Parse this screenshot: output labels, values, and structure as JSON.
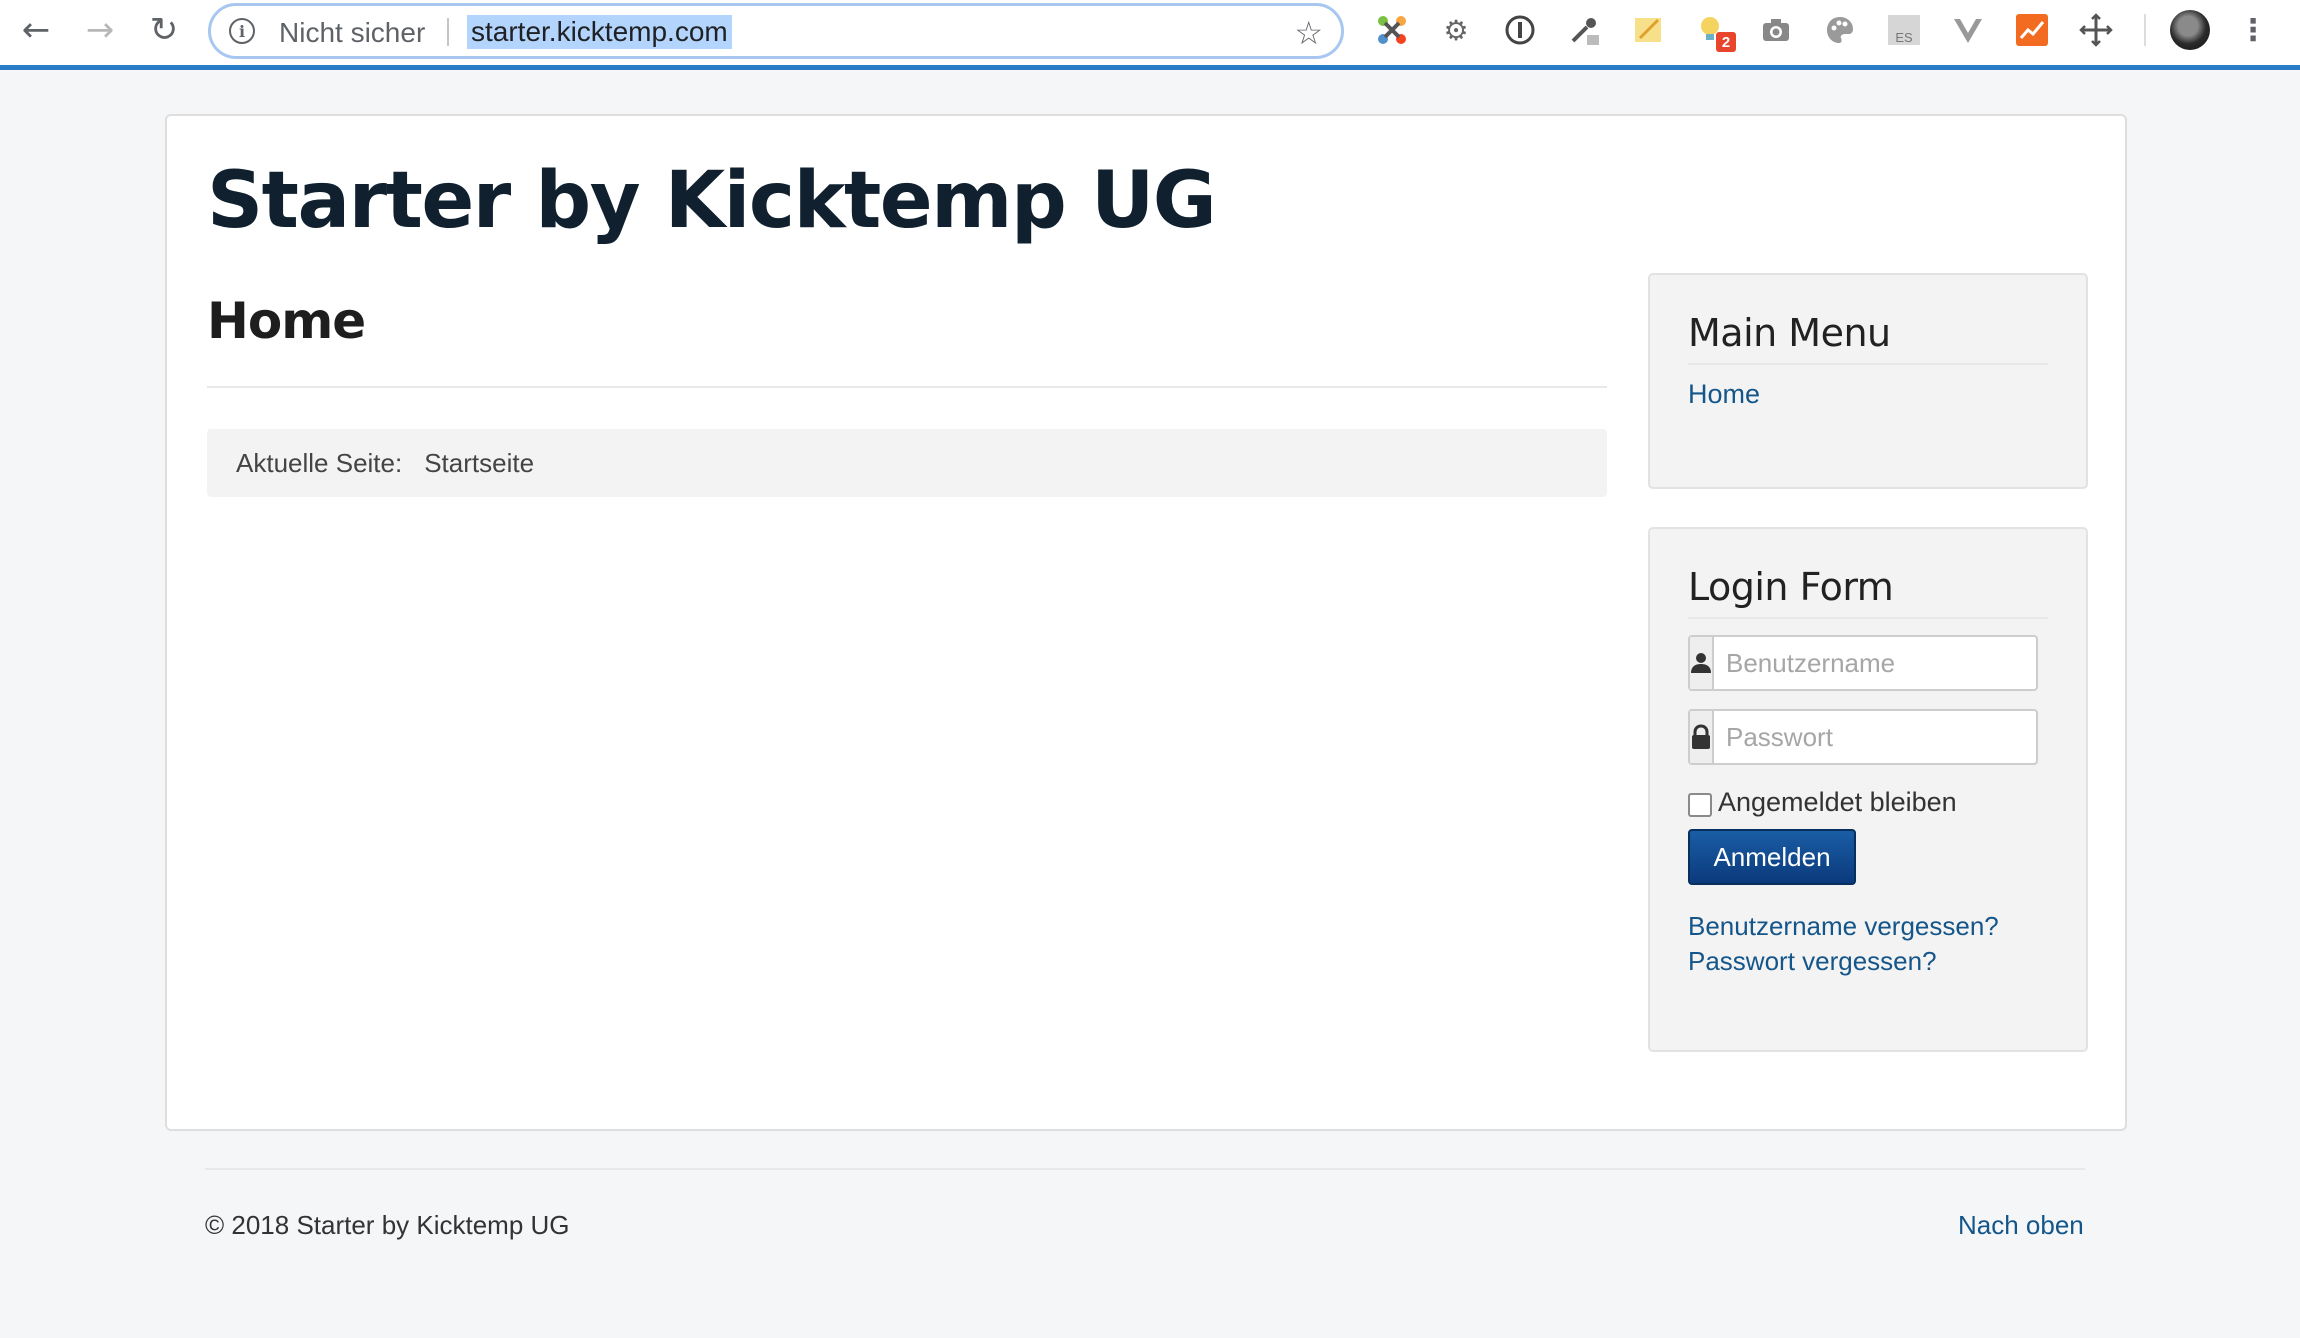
{
  "browser": {
    "security_label": "Nicht sicher",
    "url": "starter.kicktemp.com",
    "extension_badge": "2",
    "extension_es_label": "ES"
  },
  "site": {
    "title": "Starter by Kicktemp UG"
  },
  "main": {
    "heading": "Home",
    "breadcrumb": {
      "label": "Aktuelle Seite:",
      "current": "Startseite"
    }
  },
  "main_menu": {
    "title": "Main Menu",
    "items": [
      {
        "label": "Home"
      }
    ]
  },
  "login_form": {
    "title": "Login Form",
    "username_placeholder": "Benutzername",
    "password_placeholder": "Passwort",
    "remember_label": "Angemeldet bleiben",
    "submit_label": "Anmelden",
    "forgot_username": "Benutzername vergessen?",
    "forgot_password": "Passwort vergessen?"
  },
  "footer": {
    "copyright": "© 2018 Starter by Kicktemp UG",
    "back_to_top": "Nach oben"
  },
  "colors": {
    "accent_blue": "#2a7cc7",
    "link": "#15568a",
    "button": "#0b3a7c",
    "page_bg": "#f4f6f7"
  }
}
